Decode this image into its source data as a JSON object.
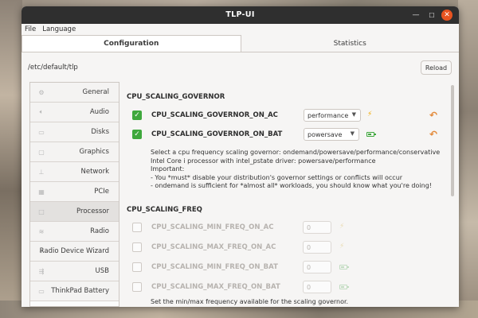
{
  "window": {
    "title": "TLP-UI"
  },
  "menubar": {
    "items": [
      "File",
      "Language"
    ]
  },
  "tabs": [
    {
      "label": "Configuration",
      "active": true
    },
    {
      "label": "Statistics",
      "active": false
    }
  ],
  "config_path": "/etc/default/tlp",
  "reload_label": "Reload",
  "sidebar": {
    "items": [
      {
        "label": "General",
        "icon": "settings-icon"
      },
      {
        "label": "Audio",
        "icon": "speaker-icon"
      },
      {
        "label": "Disks",
        "icon": "disk-icon"
      },
      {
        "label": "Graphics",
        "icon": "monitor-icon"
      },
      {
        "label": "Network",
        "icon": "network-icon"
      },
      {
        "label": "PCIe",
        "icon": "pcie-icon"
      },
      {
        "label": "Processor",
        "icon": "processor-icon",
        "selected": true
      },
      {
        "label": "Radio",
        "icon": "wifi-icon"
      },
      {
        "label": "Radio Device Wizard",
        "icon": "wizard-icon"
      },
      {
        "label": "USB",
        "icon": "usb-icon"
      },
      {
        "label": "ThinkPad Battery",
        "icon": "battery-icon"
      }
    ]
  },
  "governor": {
    "section_title": "CPU_SCALING_GOVERNOR",
    "rows": [
      {
        "name": "CPU_SCALING_GOVERNOR_ON_AC",
        "checked": true,
        "value": "performance",
        "power": "ac"
      },
      {
        "name": "CPU_SCALING_GOVERNOR_ON_BAT",
        "checked": true,
        "value": "powersave",
        "power": "battery"
      }
    ],
    "description": [
      "Select a cpu frequency scaling governor: ondemand/powersave/performance/conservative",
      "Intel Core i processor with intel_pstate driver: powersave/performance",
      "Important:",
      "- You *must* disable your distribution's governor settings or conflicts will occur",
      "- ondemand is sufficient for *almost all* workloads, you should know what you're doing!"
    ]
  },
  "freq": {
    "section_title": "CPU_SCALING_FREQ",
    "rows": [
      {
        "name": "CPU_SCALING_MIN_FREQ_ON_AC",
        "checked": false,
        "value": "0",
        "power": "ac"
      },
      {
        "name": "CPU_SCALING_MAX_FREQ_ON_AC",
        "checked": false,
        "value": "0",
        "power": "ac"
      },
      {
        "name": "CPU_SCALING_MIN_FREQ_ON_BAT",
        "checked": false,
        "value": "0",
        "power": "battery"
      },
      {
        "name": "CPU_SCALING_MAX_FREQ_ON_BAT",
        "checked": false,
        "value": "0",
        "power": "battery"
      }
    ],
    "description": "Set the min/max frequency available for the scaling governor."
  },
  "colors": {
    "accent_close": "#e95420",
    "check_green": "#3fa83d",
    "undo_orange": "#e38a3b",
    "bolt_yellow": "#f0a800"
  }
}
